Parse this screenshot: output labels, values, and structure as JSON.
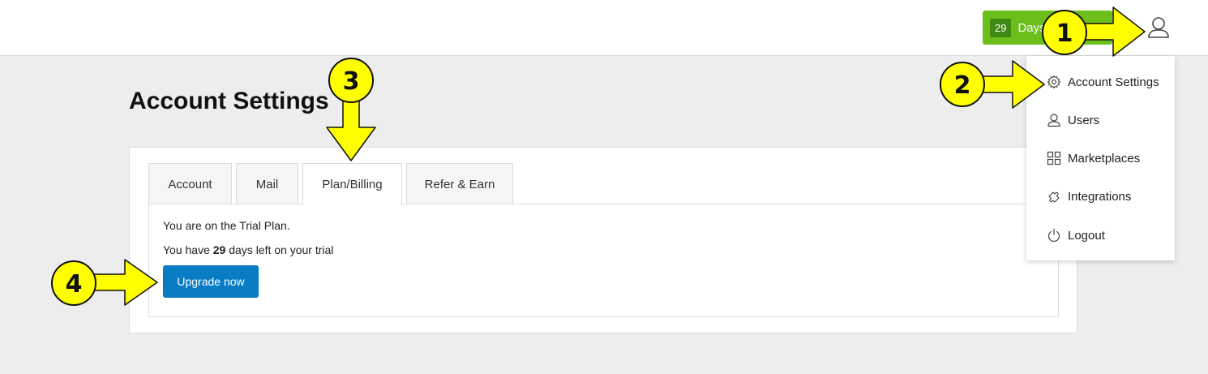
{
  "header": {
    "trial_badge": {
      "count": "29",
      "text": "Days left"
    }
  },
  "page": {
    "title": "Account Settings"
  },
  "tabs": [
    {
      "label": "Account"
    },
    {
      "label": "Mail"
    },
    {
      "label": "Plan/Billing"
    },
    {
      "label": "Refer & Earn"
    }
  ],
  "active_tab": "Plan/Billing",
  "billing": {
    "plan_text": "You are on the Trial Plan.",
    "days_prefix": "You have ",
    "days_value": "29",
    "days_suffix": " days left on your trial",
    "upgrade_label": "Upgrade now"
  },
  "user_menu": {
    "items": [
      {
        "label": "Account Settings",
        "icon": "gear-icon"
      },
      {
        "label": "Users",
        "icon": "user-icon"
      },
      {
        "label": "Marketplaces",
        "icon": "grid-icon"
      },
      {
        "label": "Integrations",
        "icon": "puzzle-icon"
      },
      {
        "label": "Logout",
        "icon": "power-icon"
      }
    ]
  },
  "annotations": [
    "1",
    "2",
    "3",
    "4"
  ],
  "colors": {
    "trial_badge": "#6cbf1b",
    "primary_button": "#0a7cc4",
    "annotation_arrow": "#ffff00"
  }
}
